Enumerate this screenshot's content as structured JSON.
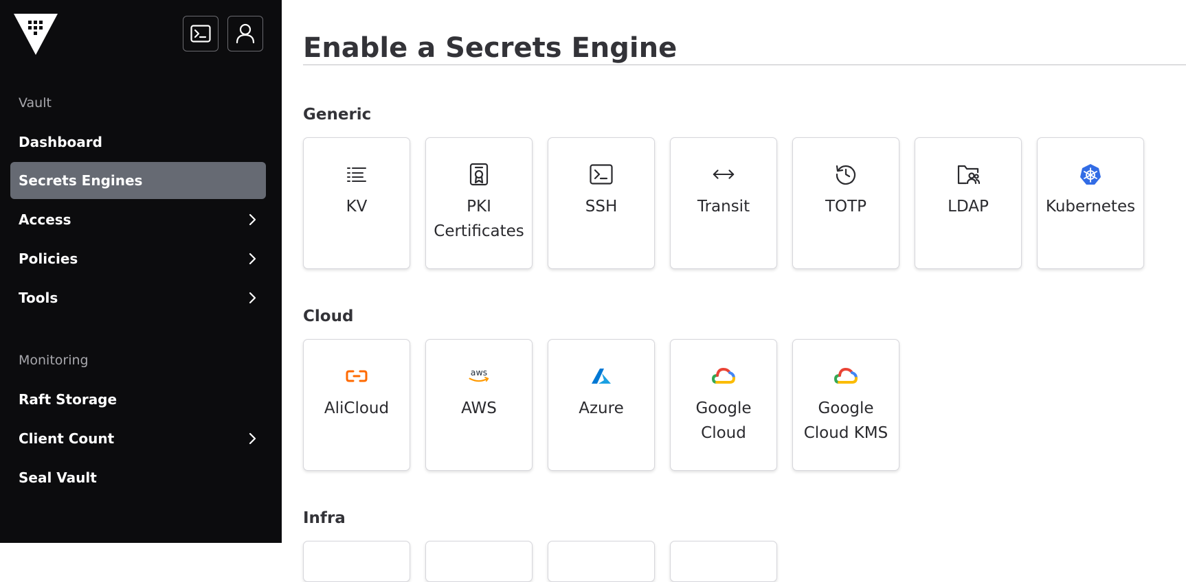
{
  "sidebar": {
    "sections": {
      "vault": "Vault",
      "monitoring": "Monitoring"
    },
    "vault_items": [
      {
        "label": "Dashboard",
        "has_chevron": false
      },
      {
        "label": "Secrets Engines",
        "active": true,
        "has_chevron": false
      },
      {
        "label": "Access",
        "has_chevron": true
      },
      {
        "label": "Policies",
        "has_chevron": true
      },
      {
        "label": "Tools",
        "has_chevron": true
      }
    ],
    "monitoring_items": [
      {
        "label": "Raft Storage",
        "has_chevron": false
      },
      {
        "label": "Client Count",
        "has_chevron": true
      },
      {
        "label": "Seal Vault",
        "has_chevron": false
      }
    ]
  },
  "main": {
    "title": "Enable a Secrets Engine",
    "groups": {
      "generic": {
        "title": "Generic",
        "engines": [
          {
            "label": "KV",
            "icon": "list-icon"
          },
          {
            "label": "PKI Certificates",
            "icon": "certificate-icon"
          },
          {
            "label": "SSH",
            "icon": "terminal-icon"
          },
          {
            "label": "Transit",
            "icon": "arrows-horizontal-icon"
          },
          {
            "label": "TOTP",
            "icon": "history-icon"
          },
          {
            "label": "LDAP",
            "icon": "folder-users-icon"
          },
          {
            "label": "Kubernetes",
            "icon": "kubernetes-icon"
          }
        ]
      },
      "cloud": {
        "title": "Cloud",
        "engines": [
          {
            "label": "AliCloud",
            "icon": "alicloud-icon"
          },
          {
            "label": "AWS",
            "icon": "aws-icon"
          },
          {
            "label": "Azure",
            "icon": "azure-icon"
          },
          {
            "label": "Google Cloud",
            "icon": "google-cloud-icon"
          },
          {
            "label": "Google Cloud KMS",
            "icon": "google-cloud-icon"
          }
        ]
      },
      "infra": {
        "title": "Infra"
      }
    }
  },
  "colors": {
    "sidebar_bg": "#0c0c0e",
    "active_item_bg": "#666a73",
    "kubernetes": "#326ce5",
    "alicloud": "#ff6a00",
    "aws": "#ff9900",
    "azure": "#0078d4"
  }
}
